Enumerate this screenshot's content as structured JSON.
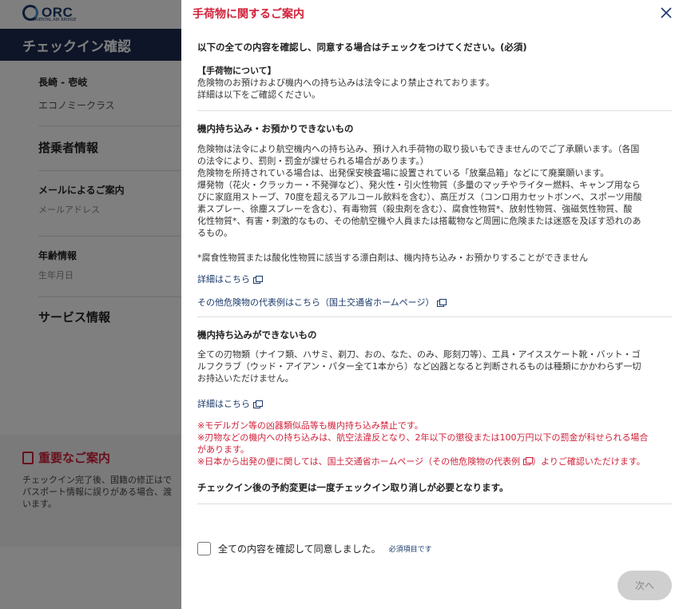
{
  "background": {
    "logo_text": "ORC",
    "logo_subtext": "ORIENTAL AIR BRIDGE",
    "page_title": "チェックイン確認",
    "flight": {
      "route": "長崎 - 壱岐",
      "cabin": "エコノミークラス"
    },
    "passenger_section": "搭乗者情報",
    "email_guidance": {
      "label": "メールによるご案内",
      "placeholder": "メールアドレス"
    },
    "age": {
      "label": "年齢情報",
      "placeholder": "生年月日"
    },
    "service_section": "サービス情報",
    "notice": {
      "title": "重要なご案内",
      "lines": [
        "チェックイン完了後、国籍の修正はで",
        "パスポート情報に誤りがある場合、渡",
        "います。"
      ]
    }
  },
  "modal": {
    "title": "手荷物に関するご案内",
    "instruction": "以下の全ての内容を確認し、同意する場合はチェックをつけてください。(必須)",
    "about": {
      "title": "【手荷物について】",
      "lines": [
        "危険物のお預けおよび機内への持ち込みは法令により禁止されております。",
        "詳細は以下をご確認ください。"
      ]
    },
    "section1": {
      "title": "機内持ち込み・お預かりできないもの",
      "lines": [
        "危険物は法令により航空機内への持ち込み、預け入れ手荷物の取り扱いもできませんのでご了承願います。（各国",
        "の法令により、罰則・罰金が課せられる場合があります。）",
        "危険物を所持されている場合は、出発保安検査場に設置されている「放棄品箱」などにて廃棄願います。",
        "爆発物（花火・クラッカー・不発弾など）、発火性・引火性物質（多量のマッチやライター燃料、キャンプ用なら",
        "びに家庭用ストーブ、70度を超えるアルコール飲料を含む）、高圧ガス（コンロ用カセットボンベ、スポーツ用酸",
        "素スプレー、徐塵スプレーを含む）、有毒物質（殺虫剤を含む）、腐食性物質*、放射性物質、強磁気性物質、酸",
        "化性物質*、有害・刺激的なもの、その他航空機や人員または搭載物など周囲に危険または迷惑を及ぼす恐れのあ",
        "るもの。"
      ],
      "footnote": "*腐食性物質または酸化性物質に該当する漂白剤は、機内持ち込み・お預かりすることができません",
      "detail_link": "詳細はこちら",
      "other_link": "その他危険物の代表例はこちら（国土交通省ホームページ）"
    },
    "section2": {
      "title": "機内持ち込みができないもの",
      "lines": [
        "全ての刃物類（ナイフ類、ハサミ、剃刀、おの、なた、のみ、彫刻刀等）、工具・アイススケート靴・バット・ゴ",
        "ルフクラブ（ウッド・アイアン・パター全て1本から）など凶器となると判断されるものは種類にかかわらず一切",
        "お持込いただけません。"
      ],
      "detail_link": "詳細はこちら",
      "warnings": [
        "※モデルガン等の凶器類似品等も機内持ち込み禁止です。",
        "※刃物などの機内への持ち込みは、航空法違反となり、2年以下の懲役または100万円以下の罰金が科せられる場合",
        "があります。"
      ],
      "warning_last_pre": "※日本から出発の便に関しては、国土交通省ホームページ（その他危険物の代表例",
      "warning_last_post": "）よりご確認いただけます。"
    },
    "change_notice": "チェックイン後の予約変更は一度チェックイン取り消しが必要となります。",
    "agree_label": "全ての内容を確認して同意しました。",
    "required_label": "必須項目です",
    "next_button": "次へ",
    "colors": {
      "accent_red": "#d0213a",
      "navy": "#1f2a50",
      "link": "#1b3a6b",
      "disabled_button": "#cfcfcf"
    },
    "icons": [
      "close-icon",
      "external-link-icon",
      "document-icon"
    ]
  }
}
